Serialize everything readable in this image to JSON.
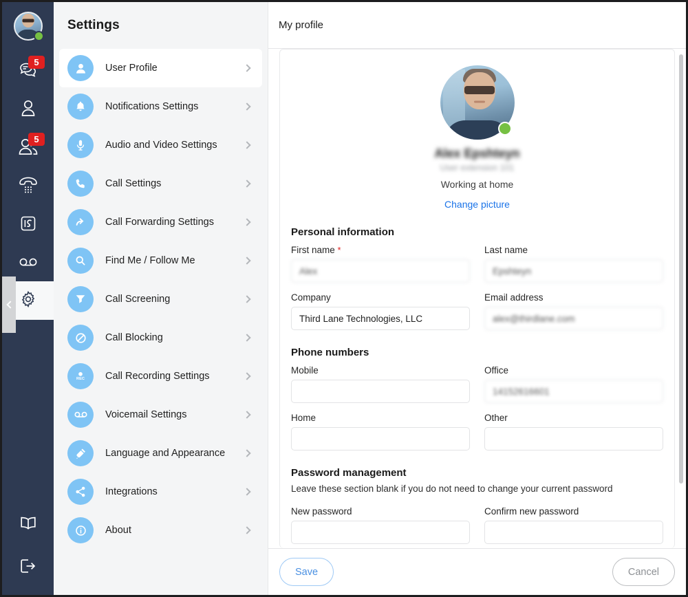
{
  "rail": {
    "avatar": {
      "name": "user-avatar",
      "presence": "online",
      "presence_color": "#76c043"
    },
    "items": [
      {
        "icon": "chat-icon",
        "badge": "5"
      },
      {
        "icon": "contact-icon",
        "badge": ""
      },
      {
        "icon": "contacts-group-icon",
        "badge": "5"
      },
      {
        "icon": "dialpad-phone-icon",
        "badge": ""
      },
      {
        "icon": "call-history-icon",
        "badge": ""
      },
      {
        "icon": "voicemail-icon",
        "badge": ""
      },
      {
        "icon": "gear-icon",
        "badge": "",
        "active": true
      }
    ],
    "bottom_items": [
      {
        "icon": "book-icon"
      },
      {
        "icon": "logout-icon"
      }
    ],
    "collapse_icon": "chevron-left-icon"
  },
  "settings": {
    "title": "Settings",
    "items": [
      {
        "label": "User Profile",
        "icon": "person-icon",
        "active": true
      },
      {
        "label": "Notifications Settings",
        "icon": "bell-icon",
        "active": false
      },
      {
        "label": "Audio and Video Settings",
        "icon": "microphone-icon",
        "active": false
      },
      {
        "label": "Call Settings",
        "icon": "phone-icon",
        "active": false
      },
      {
        "label": "Call Forwarding Settings",
        "icon": "arrow-forward-icon",
        "active": false
      },
      {
        "label": "Find Me / Follow Me",
        "icon": "search-icon",
        "active": false
      },
      {
        "label": "Call Screening",
        "icon": "funnel-icon",
        "active": false
      },
      {
        "label": "Call Blocking",
        "icon": "block-icon",
        "active": false
      },
      {
        "label": "Call Recording Settings",
        "icon": "record-icon",
        "active": false
      },
      {
        "label": "Voicemail Settings",
        "icon": "voicemail-icon",
        "active": false
      },
      {
        "label": "Language and Appearance",
        "icon": "brush-icon",
        "active": false
      },
      {
        "label": "Integrations",
        "icon": "share-icon",
        "active": false
      },
      {
        "label": "About",
        "icon": "info-icon",
        "active": false
      }
    ]
  },
  "content": {
    "header_title": "My profile",
    "profile": {
      "name": "Alex Epshteyn",
      "extension": "User extension 101",
      "status": "Working at home",
      "change_picture_label": "Change picture",
      "link_color": "#1a73e8"
    },
    "personal": {
      "section_title": "Personal information",
      "first_name_label": "First name",
      "first_name_required": "*",
      "first_name_value": "Alex",
      "last_name_label": "Last name",
      "last_name_value": "Epshteyn",
      "company_label": "Company",
      "company_value": "Third Lane Technologies, LLC",
      "email_label": "Email address",
      "email_value": "alex@thirdlane.com"
    },
    "phones": {
      "section_title": "Phone numbers",
      "mobile_label": "Mobile",
      "mobile_value": "",
      "office_label": "Office",
      "office_value": "14152616601",
      "home_label": "Home",
      "home_value": "",
      "other_label": "Other",
      "other_value": ""
    },
    "password": {
      "section_title": "Password management",
      "hint": "Leave these section blank if you do not need to change your current password",
      "new_label": "New password",
      "new_value": "",
      "confirm_label": "Confirm new password",
      "confirm_value": ""
    },
    "footer": {
      "save_label": "Save",
      "cancel_label": "Cancel"
    }
  }
}
